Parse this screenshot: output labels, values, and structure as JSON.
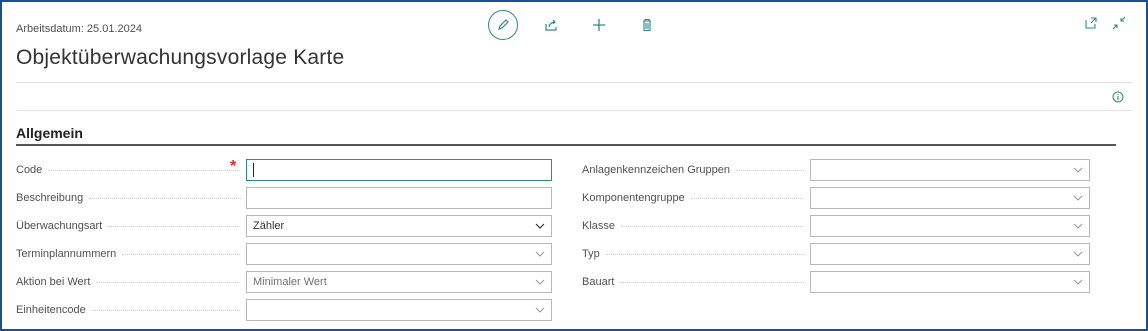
{
  "header": {
    "work_date": "Arbeitsdatum: 25.01.2024",
    "title": "Objektüberwachungsvorlage Karte"
  },
  "toolbar": {
    "icons": [
      "edit-icon",
      "share-icon",
      "new-icon",
      "delete-icon"
    ]
  },
  "section": {
    "title": "Allgemein"
  },
  "left_fields": [
    {
      "label": "Code",
      "value": "",
      "required": true,
      "type": "text",
      "focused": true
    },
    {
      "label": "Beschreibung",
      "value": "",
      "type": "text"
    },
    {
      "label": "Überwachungsart",
      "value": "Zähler",
      "type": "select"
    },
    {
      "label": "Terminplannummern",
      "value": "",
      "type": "select"
    },
    {
      "label": "Aktion bei Wert",
      "value": "Minimaler Wert",
      "type": "select"
    },
    {
      "label": "Einheitencode",
      "value": "",
      "type": "select"
    }
  ],
  "right_fields": [
    {
      "label": "Anlagenkennzeichen Gruppen",
      "value": "",
      "type": "select"
    },
    {
      "label": "Komponentengruppe",
      "value": "",
      "type": "select"
    },
    {
      "label": "Klasse",
      "value": "",
      "type": "select"
    },
    {
      "label": "Typ",
      "value": "",
      "type": "select"
    },
    {
      "label": "Bauart",
      "value": "",
      "type": "select"
    }
  ],
  "colors": {
    "accent": "#2e8a8a",
    "required": "#e3242b",
    "frame": "#1f4e8c"
  }
}
